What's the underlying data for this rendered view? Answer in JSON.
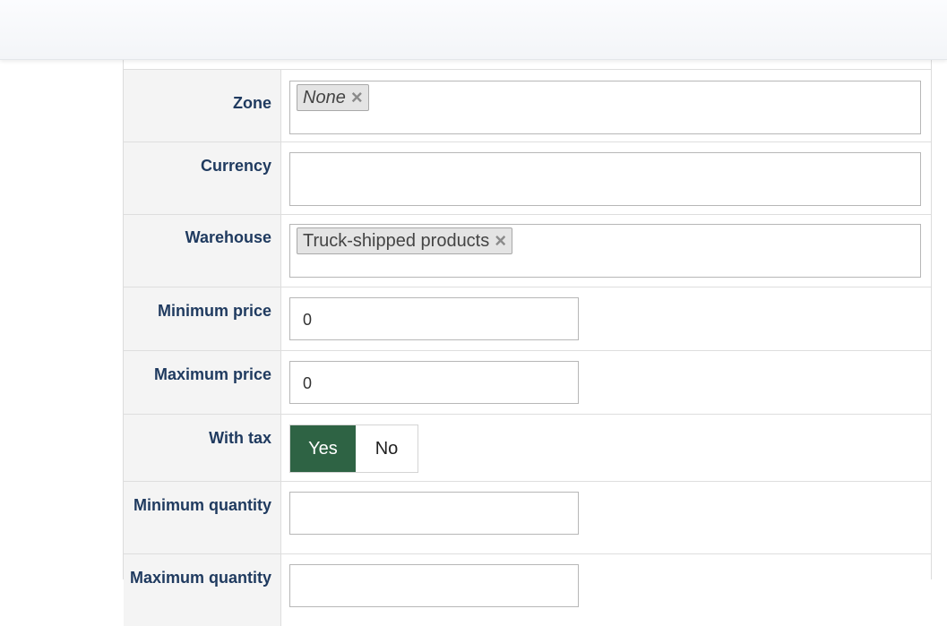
{
  "fields": {
    "zone": {
      "label": "Zone",
      "tags": [
        "None"
      ],
      "tag_close": "×"
    },
    "currency": {
      "label": "Currency",
      "tags": []
    },
    "warehouse": {
      "label": "Warehouse",
      "tags": [
        "Truck-shipped products"
      ],
      "tag_close": "×"
    },
    "min_price": {
      "label": "Minimum price",
      "value": "0"
    },
    "max_price": {
      "label": "Maximum price",
      "value": "0"
    },
    "with_tax": {
      "label": "With tax",
      "yes": "Yes",
      "no": "No",
      "selected": "Yes",
      "selected_color": "#2e6344"
    },
    "min_quantity": {
      "label": "Minimum quantity",
      "value": ""
    },
    "max_quantity": {
      "label": "Maximum quantity",
      "value": ""
    }
  },
  "colors": {
    "label_text": "#1f3a5f",
    "label_bg": "#f4f4f4"
  }
}
